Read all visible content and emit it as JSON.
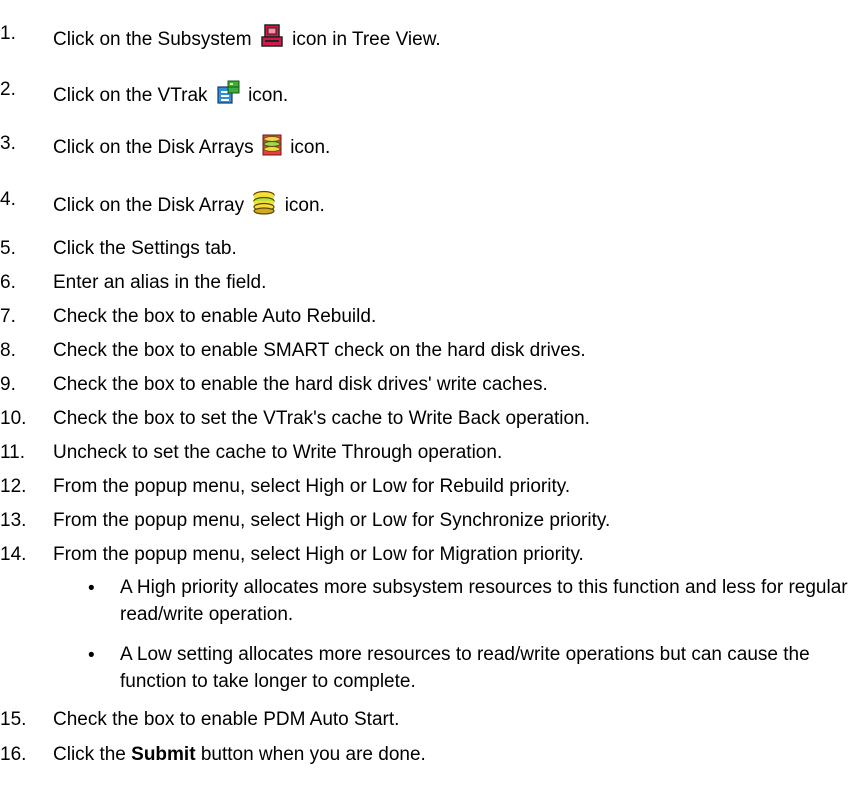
{
  "steps": [
    {
      "num": "1.",
      "pre": "Click on the Subsystem",
      "post": "icon in Tree View.",
      "icon": "subsystem-icon"
    },
    {
      "num": "2.",
      "pre": "Click on the VTrak",
      "post": "icon.",
      "icon": "vtrak-icon"
    },
    {
      "num": "3.",
      "pre": "Click on the Disk Arrays",
      "post": "icon.",
      "icon": "disk-arrays-icon"
    },
    {
      "num": "4.",
      "pre": "Click on the Disk Array",
      "post": "icon.",
      "icon": "disk-array-icon"
    },
    {
      "num": "5.",
      "text": "Click the Settings tab."
    },
    {
      "num": "6.",
      "text": "Enter an alias in the field."
    },
    {
      "num": "7.",
      "text": "Check the box to enable Auto Rebuild."
    },
    {
      "num": "8.",
      "text": "Check the box to enable SMART check on the hard disk drives."
    },
    {
      "num": "9.",
      "text": "Check the box to enable the hard disk drives' write caches."
    },
    {
      "num": "10.",
      "text": "Check the box to set the VTrak's cache to Write Back operation."
    },
    {
      "num": "11.",
      "text": "Uncheck to set the cache to Write Through operation."
    },
    {
      "num": "12.",
      "text": "From the popup menu, select High or Low for Rebuild priority."
    },
    {
      "num": "13.",
      "text": "From the popup menu, select High or Low for Synchronize priority."
    },
    {
      "num": "14.",
      "text": "From the popup menu, select High or Low for Migration priority."
    },
    {
      "num": "15.",
      "text": "Check the box to enable PDM Auto Start."
    },
    {
      "num": "16.",
      "pre": "Click the",
      "bold": "Submit",
      "post": "button when you are done."
    }
  ],
  "bullets": [
    {
      "dot": "•",
      "text": "A High priority allocates more subsystem resources to this function and less for regular read/write operation."
    },
    {
      "dot": "•",
      "text": "A Low setting allocates more resources to read/write operations but can cause the function to take longer to complete."
    }
  ]
}
